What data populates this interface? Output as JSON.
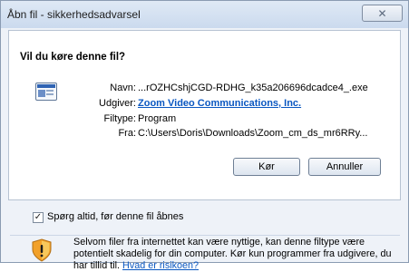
{
  "window": {
    "title": "Åbn fil - sikkerhedsadvarsel"
  },
  "prompt": {
    "question": "Vil du køre denne fil?"
  },
  "details": {
    "name_label": "Navn:",
    "name_value": "...rOZHCshjCGD-RDHG_k35a206696dcadce4_.exe",
    "publisher_label": "Udgiver:",
    "publisher_value": "Zoom Video Communications, Inc.",
    "filetype_label": "Filtype:",
    "filetype_value": "Program",
    "from_label": "Fra:",
    "from_value": "C:\\Users\\Doris\\Downloads\\Zoom_cm_ds_mr6RRy..."
  },
  "buttons": {
    "run": "Kør",
    "cancel": "Annuller"
  },
  "checkbox": {
    "label": "Spørg altid, før denne fil åbnes",
    "checked": true
  },
  "warning": {
    "text": "Selvom filer fra internettet kan være nyttige, kan denne filtype være potentielt skadelig for din computer. Kør kun programmer fra udgivere, du har tillid til.",
    "link": "Hvad er risikoen?"
  },
  "icons": {
    "close": "close-icon",
    "app": "application-icon",
    "warning": "shield-warning-icon"
  },
  "colors": {
    "link": "#0a57c1",
    "window_bg": "#eef2f8"
  }
}
